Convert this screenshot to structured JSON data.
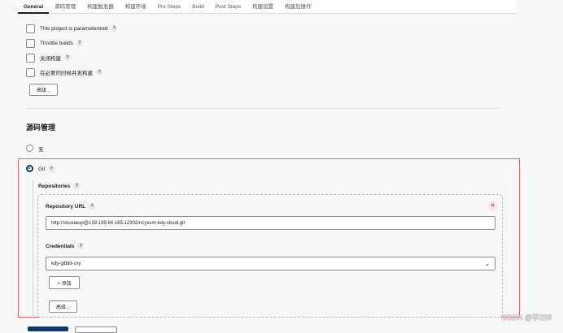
{
  "tabs": [
    "General",
    "源码管理",
    "构建触发器",
    "构建环境",
    "Pre Steps",
    "Build",
    "Post Steps",
    "构建设置",
    "构建后操作"
  ],
  "general": {
    "options": [
      {
        "label": "This project is parameterized",
        "checked": false
      },
      {
        "label": "Throttle builds",
        "checked": false
      },
      {
        "label": "关闭构建",
        "checked": false
      },
      {
        "label": "在必要的时候并发构建",
        "checked": false
      }
    ],
    "advanced_label": "高级..."
  },
  "scm": {
    "title": "源码管理",
    "none_label": "无",
    "git_label": "Git",
    "selected": "Git",
    "repositories_label": "Repositories",
    "repository_url_label": "Repository URL",
    "repository_url_value": "http://shuxiaoyi@139.199.84.165:12302/r/cyscm-kdy-cloud.git",
    "credentials_label": "Credentials",
    "credentials_value": "kdy-gitblit-sxy",
    "add_label": "+ 添加",
    "advanced_label": "高级...",
    "delete_symbol": "×"
  },
  "help_symbol": "?",
  "chevron_symbol": "⌄",
  "watermark": "CSDN @学258",
  "colors": {
    "highlight_border": "#e36a6a",
    "radio_selected": "#0b3a66",
    "delete_bg": "#fde4e4",
    "save_button": "#0b3a66"
  }
}
